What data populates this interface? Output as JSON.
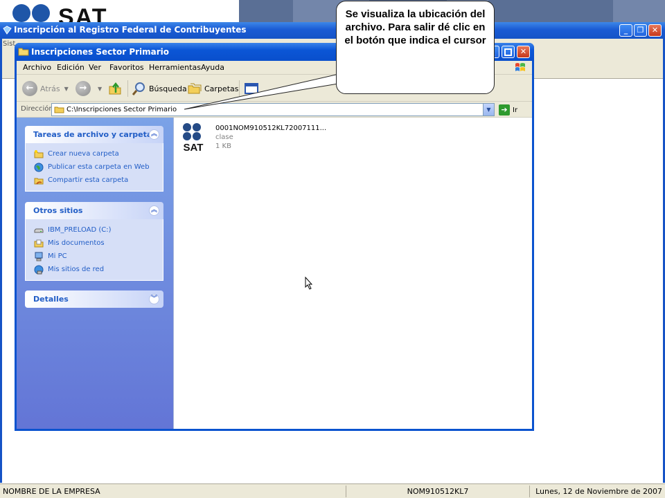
{
  "banner": {
    "logo_text": "SAT"
  },
  "outer_window": {
    "title": "Inscripción al Registro Federal de Contribuyentes",
    "menu_fragment": "Sist",
    "min_glyph": "_",
    "max_glyph": "❐",
    "close_glyph": "✕"
  },
  "explorer": {
    "title": "Inscripciones Sector Primario",
    "menu": [
      "Archivo",
      "Edición",
      "Ver",
      "Favoritos",
      "Herramientas",
      "Ayuda"
    ],
    "toolbar": {
      "back_label": "Atrás",
      "search_label": "Búsqueda",
      "folders_label": "Carpetas"
    },
    "address": {
      "label": "Dirección",
      "value": "C:\\Inscripciones Sector Primario",
      "go_label": "Ir"
    },
    "task_pane": {
      "file_tasks": {
        "title": "Tareas de archivo y carpeta",
        "items": [
          "Crear nueva carpeta",
          "Publicar esta carpeta en Web",
          "Compartir esta carpeta"
        ]
      },
      "other_places": {
        "title": "Otros sitios",
        "items": [
          "IBM_PRELOAD (C:)",
          "Mis documentos",
          "Mi PC",
          "Mis sitios de red"
        ]
      },
      "details": {
        "title": "Detalles"
      }
    },
    "file": {
      "name": "0001NOM910512KL72007111...",
      "type": "clase",
      "size": "1 KB",
      "icon_text": "SAT"
    }
  },
  "callout": {
    "text": "Se visualiza la ubicación del archivo. Para salir dé clic en el botón que indica el cursor"
  },
  "statusbar": {
    "company": "NOMBRE DE LA EMPRESA",
    "rfc": "NOM910512KL7",
    "date": "Lunes, 12 de Noviembre de 2007"
  },
  "colors": {
    "xp_blue": "#0a53cf",
    "task_link": "#215dc6",
    "pane_bg": "#7ba2e7"
  }
}
